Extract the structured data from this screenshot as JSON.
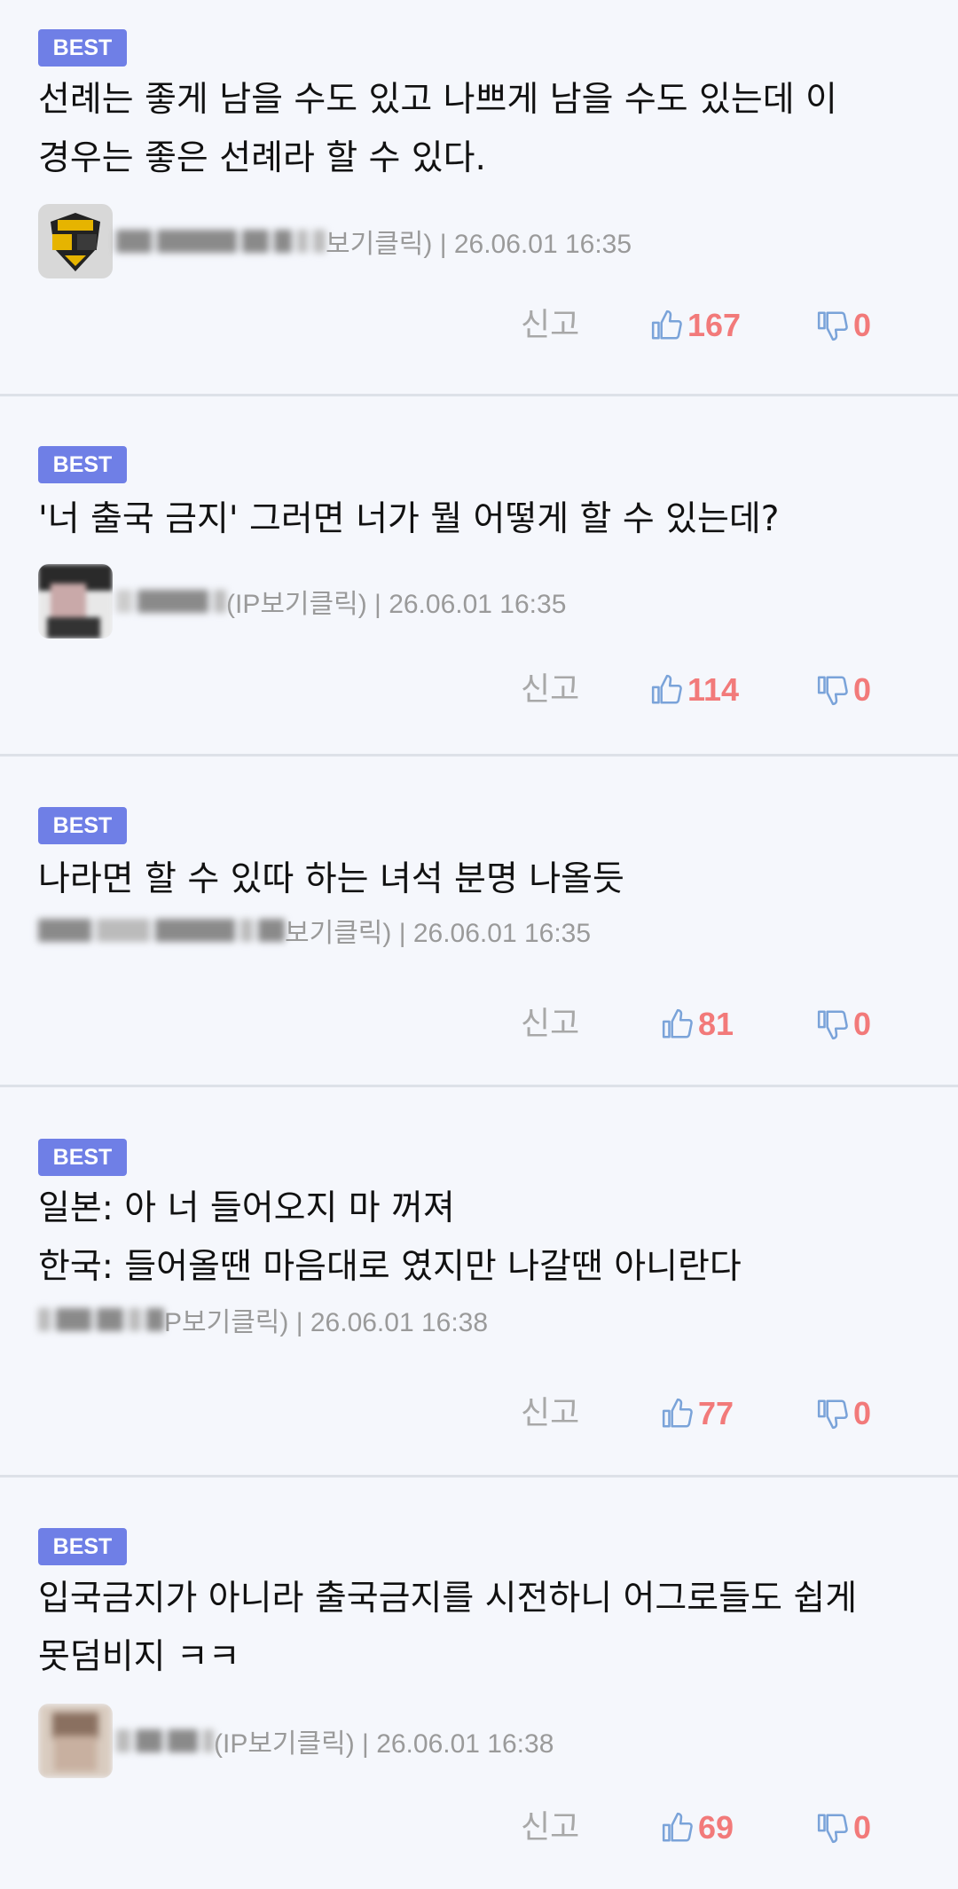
{
  "badge_label": "BEST",
  "report_label": "신고",
  "comments": [
    {
      "text_lines": [
        "선례는 좋게 남을 수도 있고 나쁘게 남을 수도 있는데 이",
        "경우는 좋은 선례라 할 수 있다."
      ],
      "meta_suffix": "보기클릭) | 26.06.01 16:35",
      "likes": "167",
      "dislikes": "0"
    },
    {
      "text_lines": [
        "'너 출국 금지' 그러면 너가 뭘 어떻게 할 수 있는데?"
      ],
      "meta_suffix": "(IP보기클릭) | 26.06.01 16:35",
      "likes": "114",
      "dislikes": "0"
    },
    {
      "text_lines": [
        "나라면 할 수 있따 하는 녀석 분명 나올듯"
      ],
      "meta_suffix": "보기클릭) | 26.06.01 16:35",
      "likes": "81",
      "dislikes": "0"
    },
    {
      "text_lines": [
        "일본: 아 너 들어오지 마 꺼져",
        "한국: 들어올땐 마음대로 였지만 나갈땐 아니란다"
      ],
      "meta_suffix": "P보기클릭) | 26.06.01 16:38",
      "likes": "77",
      "dislikes": "0"
    },
    {
      "text_lines": [
        "입국금지가 아니라 출국금지를 시전하니 어그로들도 쉽게",
        "못덤비지 ㅋㅋ"
      ],
      "meta_suffix": "(IP보기클릭) | 26.06.01 16:38",
      "likes": "69",
      "dislikes": "0"
    }
  ]
}
